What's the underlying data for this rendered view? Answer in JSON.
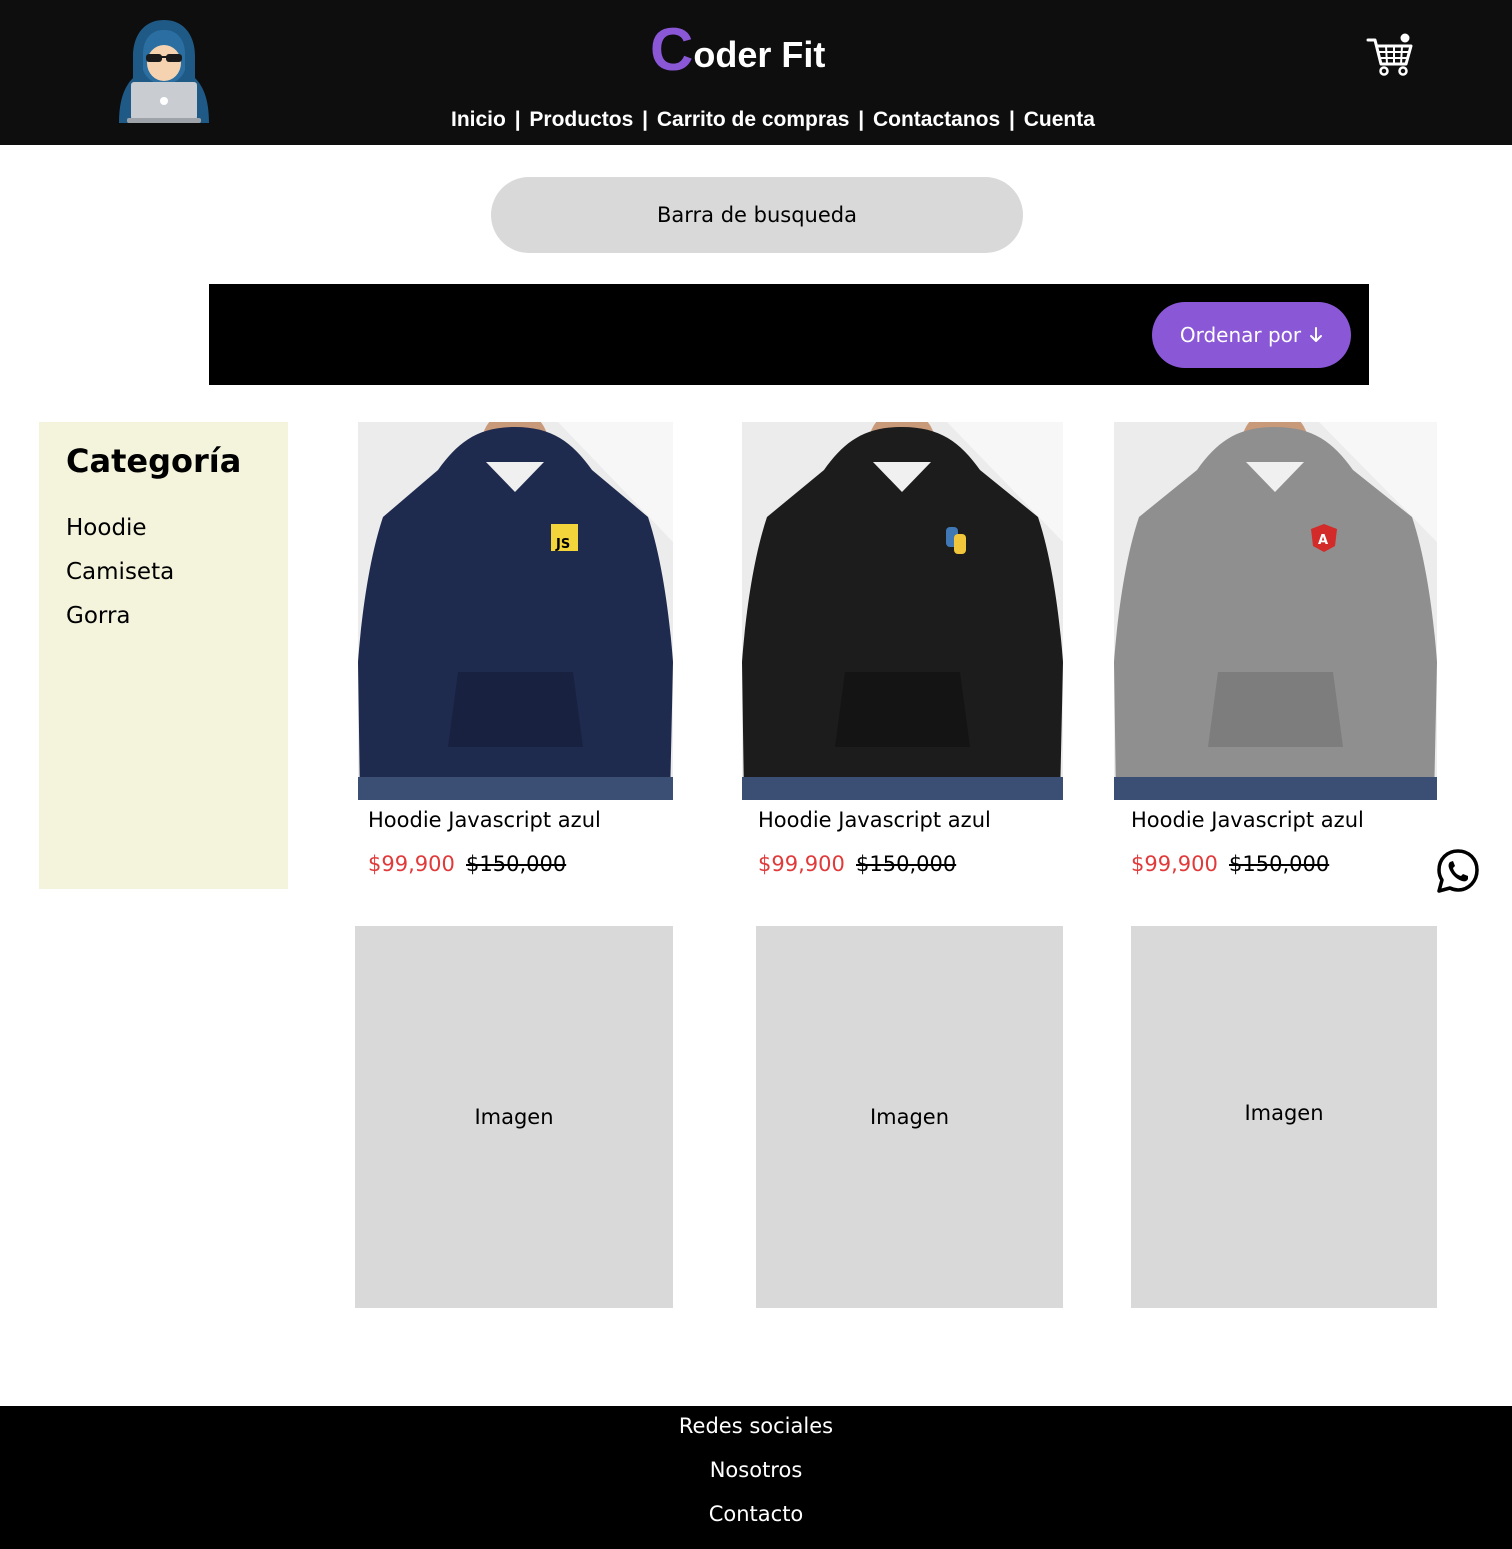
{
  "header": {
    "brand_initial": "C",
    "brand_rest": "oder Fit",
    "nav": [
      "Inicio",
      "Productos",
      "Carrito de compras",
      "Contactanos",
      "Cuenta"
    ],
    "separator": "|",
    "accent_color": "#8a57d6"
  },
  "search": {
    "placeholder": "Barra de busqueda"
  },
  "sort": {
    "label": "Ordenar por",
    "icon": "arrow-down-icon"
  },
  "sidebar": {
    "title": "Categoría",
    "items": [
      "Hoodie",
      "Camiseta",
      "Gorra"
    ]
  },
  "products": [
    {
      "title": "Hoodie Javascript azul",
      "price": "$99,900",
      "old_price": "$150,000 ",
      "color": "navy",
      "badge": "JS"
    },
    {
      "title": "Hoodie Javascript azul",
      "price": "$99,900",
      "old_price": "$150,000 ",
      "color": "black",
      "badge": "python"
    },
    {
      "title": "Hoodie Javascript azul",
      "price": "$99,900",
      "old_price": "$150,000 ",
      "color": "gray",
      "badge": "A"
    }
  ],
  "placeholders": [
    "Imagen",
    "Imagen",
    "Imagen"
  ],
  "footer": {
    "links": [
      "Redes sociales",
      "Nosotros",
      "Contacto"
    ]
  }
}
